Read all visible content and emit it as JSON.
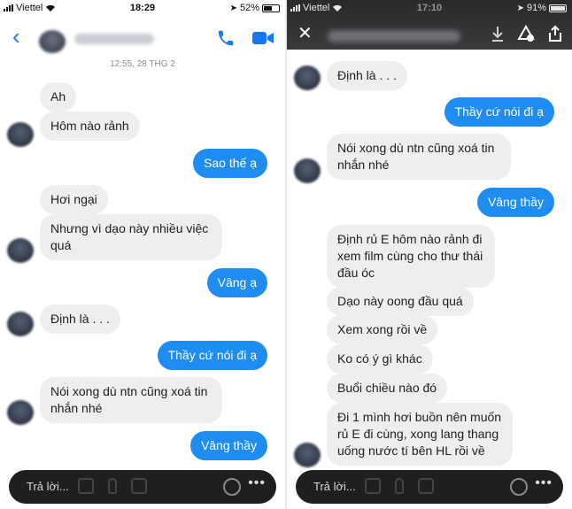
{
  "left": {
    "status": {
      "carrier": "Viettel",
      "time": "18:29",
      "battery": "52%"
    },
    "date_divider": "12:55, 28 THG 2",
    "messages": [
      {
        "side": "in",
        "text": "Ah"
      },
      {
        "side": "in",
        "text": "Hôm nào rảnh"
      },
      {
        "side": "out",
        "text": "Sao thế ạ"
      },
      {
        "side": "in",
        "text": "Hơi ngại"
      },
      {
        "side": "in",
        "text": "Nhưng vì dạo này nhiều việc quá"
      },
      {
        "side": "out",
        "text": "Vâng ạ"
      },
      {
        "side": "in",
        "text": "Định là . . ."
      },
      {
        "side": "out",
        "text": "Thầy cứ nói đi ạ"
      },
      {
        "side": "in",
        "text": "Nói xong dù ntn cũng xoá tin nhắn nhé"
      },
      {
        "side": "out",
        "text": "Vâng thầy"
      }
    ],
    "composer_placeholder": "Trả lời...",
    "more_label": "•••"
  },
  "right": {
    "status": {
      "carrier": "Viettel",
      "time": "17:10",
      "battery": "91%"
    },
    "close_label": "✕",
    "messages": [
      {
        "side": "in",
        "text": "Định là . . ."
      },
      {
        "side": "out",
        "text": "Thầy cứ nói đi ạ"
      },
      {
        "side": "in",
        "text": "Nói xong dù ntn cũng xoá tin nhắn nhé"
      },
      {
        "side": "out",
        "text": "Vâng thầy"
      },
      {
        "side": "in",
        "text": "Định rủ E hôm nào rảnh đi xem film cùng cho thư thái đầu óc"
      },
      {
        "side": "in",
        "text": "Dạo này oong đầu quá"
      },
      {
        "side": "in",
        "text": "Xem xong rồi về"
      },
      {
        "side": "in",
        "text": "Ko có ý gì khác"
      },
      {
        "side": "in",
        "text": "Buổi chiều nào đó"
      },
      {
        "side": "in",
        "text": "Đi 1 mình hơi buồn nên muốn rủ E đi cùng, xong lang thang uống nước tí bên HL rồi về"
      }
    ],
    "composer_placeholder": "Trả lời...",
    "more_label": "•••"
  },
  "colors": {
    "outgoing": "#1e8cf0",
    "incoming": "#eeeeef",
    "accent": "#1877f2"
  }
}
